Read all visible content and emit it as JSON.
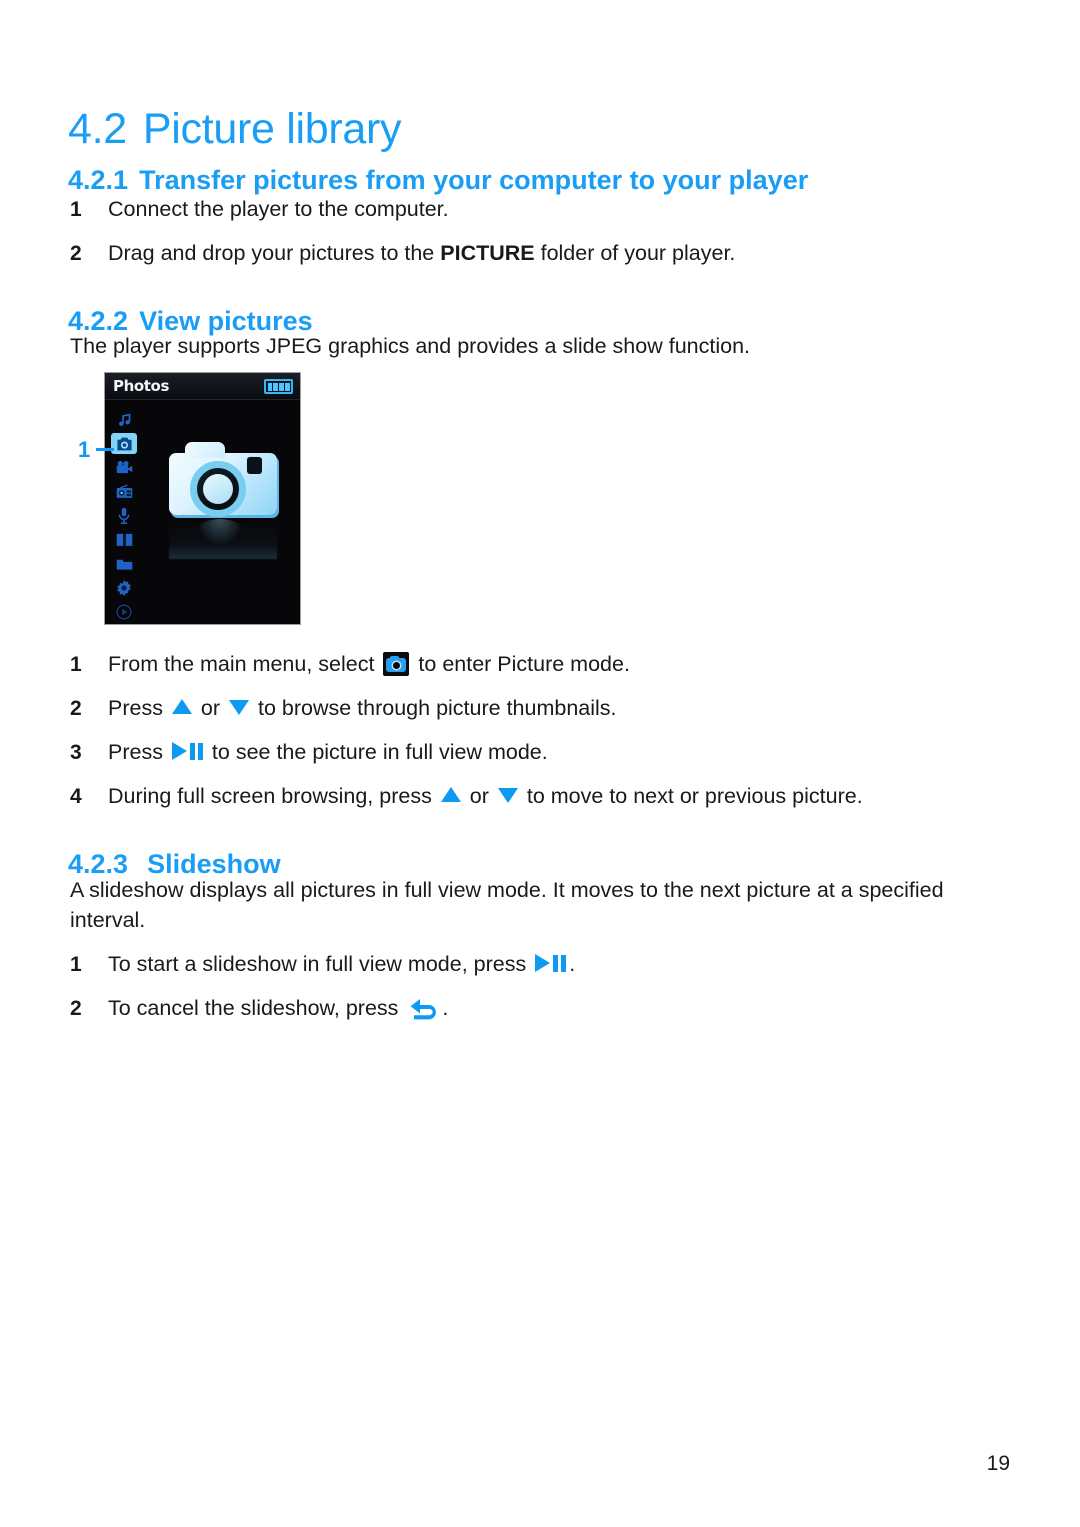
{
  "document": {
    "page_number": "19",
    "accent_color": "#1a9ef5",
    "text_color": "#1a1a1a"
  },
  "section": {
    "number": "4.2",
    "title": "Picture library"
  },
  "subsections": {
    "transfer": {
      "number": "4.2.1",
      "title": "Transfer pictures from your computer to your player",
      "steps": [
        {
          "index": "1",
          "text": "Connect the player to the computer."
        },
        {
          "index": "2",
          "text_before": "Drag and drop your pictures to the ",
          "bold": "PICTURE",
          "text_after": " folder of your player."
        }
      ]
    },
    "view": {
      "number": "4.2.2",
      "title": "View pictures",
      "intro": "The player supports JPEG graphics and provides a slide show function.",
      "steps": [
        {
          "index": "1",
          "text_before": "From the main menu, select ",
          "icon": "camera-icon",
          "text_after": " to enter Picture mode."
        },
        {
          "index": "2",
          "text_before": "Press ",
          "icon_up": "triangle-up-icon",
          "text_mid": " or ",
          "icon_down": "triangle-down-icon",
          "text_after": " to browse through picture thumbnails."
        },
        {
          "index": "3",
          "text_before": "Press ",
          "icon": "play-pause-icon",
          "text_after": " to see the picture in full view mode."
        },
        {
          "index": "4",
          "text_before": "During full screen browsing, press ",
          "icon_up": "triangle-up-icon",
          "text_mid": " or ",
          "icon_down": "triangle-down-icon",
          "text_after": " to move to next or previous picture."
        }
      ]
    },
    "slideshow": {
      "number": "4.2.3",
      "title": "Slideshow",
      "intro": "A slideshow displays all pictures in full view mode. It moves to the next picture at a specified interval.",
      "steps": [
        {
          "index": "1",
          "text_before": "To start a slideshow in full view mode, press ",
          "icon": "play-pause-icon",
          "text_after": "."
        },
        {
          "index": "2",
          "text_before": "To cancel the slideshow, press ",
          "icon": "back-arrow-icon",
          "text_after": "."
        }
      ]
    }
  },
  "device_screenshot": {
    "title": "Photos",
    "battery_icon": "battery-full-icon",
    "battery_bars": 4,
    "selected_menu_index": 1,
    "menu_icons": [
      "music-note-icon",
      "camera-icon",
      "video-camera-icon",
      "radio-icon",
      "microphone-icon",
      "book-icon",
      "folder-icon",
      "gear-icon",
      "play-circle-icon"
    ],
    "main_art": "camera-3d-icon",
    "callout_label": "1"
  }
}
